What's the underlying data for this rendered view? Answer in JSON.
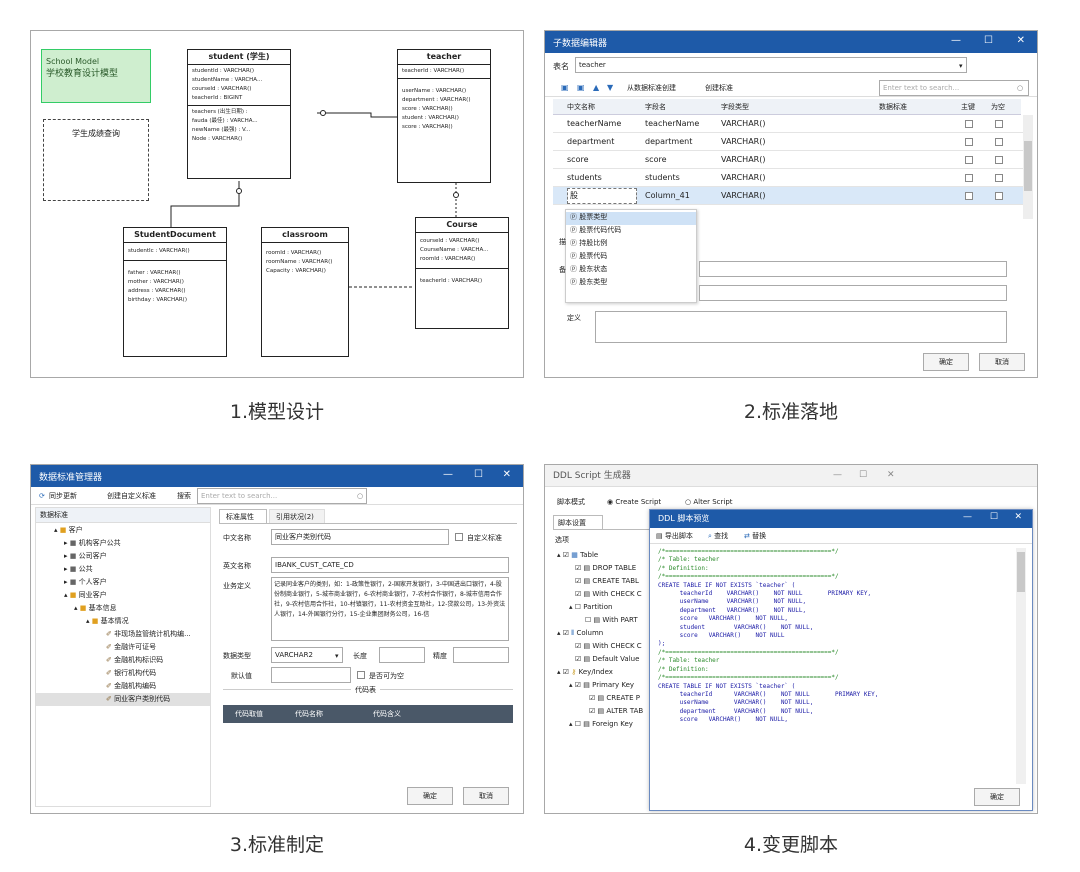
{
  "captions": {
    "p1": "1.模型设计",
    "p2": "2.标准落地",
    "p3": "3.标准制定",
    "p4": "4.变更脚本"
  },
  "model": {
    "note_line1": "School Model",
    "note_line2": "学校教育设计模型",
    "view_label": "学生成绩查询",
    "student": {
      "title": "student (学生)",
      "keys": [
        "studentId : VARCHAR()",
        "studentName : VARCHA...",
        "courseId : VARCHAR()",
        "teacherId : BIGINT"
      ],
      "fields": [
        "teachers (出生日期) :",
        "fauda (最佳) : VARCHA...",
        "newName (最强) : V...",
        "Node : VARCHAR()"
      ]
    },
    "teacher": {
      "title": "teacher",
      "keys": [
        "teacherId : VARCHAR()"
      ],
      "fields": [
        "userName : VARCHAR()",
        "department : VARCHAR()",
        "score : VARCHAR()",
        "student : VARCHAR()",
        "score : VARCHAR()"
      ]
    },
    "studentdocument": {
      "title": "StudentDocument",
      "keys": [
        "studentIc : VARCHAR()"
      ],
      "fields": [
        "father : VARCHAR()",
        "mother : VARCHAR()",
        "address : VARCHAR()",
        "birthday : VARCHAR()"
      ]
    },
    "classroom": {
      "title": "classroom",
      "keys": [
        "roomId : VARCHAR()",
        "roomName : VARCHAR()",
        "Capacity : VARCHAR()"
      ],
      "fields": []
    },
    "course": {
      "title": "Course",
      "keys": [
        "courseId : VARCHAR()",
        "CourseName : VARCHA...",
        "roomId : VARCHAR()"
      ],
      "fields": [
        "teacherId : VARCHAR()"
      ]
    }
  },
  "std": {
    "title": "子数据编辑器",
    "table_label": "表名",
    "table_value": "teacher",
    "toolbar": {
      "from_std": "从数据标准创建",
      "create_std": "创建标准",
      "search_placeholder": "Enter text to search..."
    },
    "columns": [
      "中文名称",
      "字段名",
      "字段类型",
      "数据标准",
      "主键",
      "为空"
    ],
    "rows": [
      {
        "cn": "teacherName",
        "name": "teacherName",
        "type": "VARCHAR()"
      },
      {
        "cn": "department",
        "name": "department",
        "type": "VARCHAR()"
      },
      {
        "cn": "score",
        "name": "score",
        "type": "VARCHAR()"
      },
      {
        "cn": "students",
        "name": "students",
        "type": "VARCHAR()"
      },
      {
        "cn": "股",
        "name": "Column_41",
        "type": "VARCHAR()"
      }
    ],
    "dropdown": [
      "股票类型",
      "股票代码代码",
      "持股比例",
      "股票代码",
      "股东状态",
      "股东类型"
    ],
    "form_labels": [
      "描",
      "备",
      "定义"
    ],
    "ok": "确定",
    "cancel": "取消"
  },
  "mgr": {
    "title": "数据标准管理器",
    "toolbar": {
      "sync": "同步更新",
      "custom": "创建自定义标准",
      "search_label": "搜索",
      "search_placeholder": "Enter text to search..."
    },
    "tree_title": "数据标准",
    "tree": [
      "客户",
      "机构客户公共",
      "公司客户",
      "公共",
      "个人客户",
      "同业客户",
      "基本信息",
      "基本情况",
      "非现场监管统计机构编...",
      "金融许可证号",
      "金融机构标识码",
      "银行机构代码",
      "金融机构编码",
      "同业客户类别代码"
    ],
    "tabs": [
      "标准属性",
      "引用状况(2)"
    ],
    "cn_label": "中文名称",
    "cn_value": "同业客户类别代码",
    "custom_chk": "自定义标准",
    "en_label": "英文名称",
    "en_value": "IBANK_CUST_CATE_CD",
    "def_label": "业务定义",
    "def_value": "记录同业客户的类别，如：1-政策性银行，2-国家开发银行，3-中国进出口银行，4-股份制商业银行，5-城市商业银行，6-农村商业银行，7-农村合作银行，8-城市信用合作社，9-农村信用合作社，10-村镇银行，11-农村资金互助社，12-贷款公司，13-外资法人银行，14-外国银行分行，15-企业集团财务公司，16-信",
    "type_label": "数据类型",
    "type_value": "VARCHAR2",
    "len_label": "长度",
    "prec_label": "精度",
    "default_label": "默认值",
    "nullable": "是否可为空",
    "code_section": "代码表",
    "code_cols": [
      "代码取值",
      "代码名称",
      "代码含义"
    ],
    "ok": "确定",
    "cancel": "取消"
  },
  "ddl": {
    "title": "DDL Script 生成器",
    "mode_label": "脚本模式",
    "mode_create": "Create Script",
    "mode_alter": "Alter Script",
    "tab": "脚本设置",
    "options_label": "选项",
    "tree": [
      "Table",
      "DROP TABLE",
      "CREATE TABL",
      "With CHECK C",
      "Partition",
      "With PART",
      "Column",
      "With CHECK C",
      "Default Value",
      "Key/Index",
      "Primary Key",
      "CREATE P",
      "ALTER TAB",
      "Foreign Key"
    ],
    "preview_title": "DDL 脚本预览",
    "preview_toolbar": [
      "导出脚本",
      "查找",
      "替换"
    ],
    "code": [
      {
        "t": "c",
        "v": "/*==============================================*/"
      },
      {
        "t": "c",
        "v": "/* Table: teacher"
      },
      {
        "t": "c",
        "v": "/* Definition:"
      },
      {
        "t": "c",
        "v": "/*==============================================*/"
      },
      {
        "t": "k",
        "v": "CREATE TABLE IF NOT EXISTS `teacher` ("
      },
      {
        "t": "k",
        "v": "      teacherId    VARCHAR()    NOT NULL       PRIMARY KEY,"
      },
      {
        "t": "k",
        "v": "      userName     VARCHAR()    NOT NULL,"
      },
      {
        "t": "k",
        "v": "      department   VARCHAR()    NOT NULL,"
      },
      {
        "t": "k",
        "v": "      score   VARCHAR()    NOT NULL,"
      },
      {
        "t": "k",
        "v": "      student        VARCHAR()    NOT NULL,"
      },
      {
        "t": "k",
        "v": "      score   VARCHAR()    NOT NULL"
      },
      {
        "t": "k",
        "v": ");"
      },
      {
        "t": "c",
        "v": "/*==============================================*/"
      },
      {
        "t": "c",
        "v": "/* Table: teacher"
      },
      {
        "t": "c",
        "v": "/* Definition:"
      },
      {
        "t": "c",
        "v": "/*==============================================*/"
      },
      {
        "t": "k",
        "v": "CREATE TABLE IF NOT EXISTS `teacher` ("
      },
      {
        "t": "k",
        "v": "      teacherId      VARCHAR()    NOT NULL       PRIMARY KEY,"
      },
      {
        "t": "k",
        "v": "      userName       VARCHAR()    NOT NULL,"
      },
      {
        "t": "k",
        "v": "      department     VARCHAR()    NOT NULL,"
      },
      {
        "t": "k",
        "v": "      score   VARCHAR()    NOT NULL,"
      }
    ],
    "ok": "确定"
  }
}
